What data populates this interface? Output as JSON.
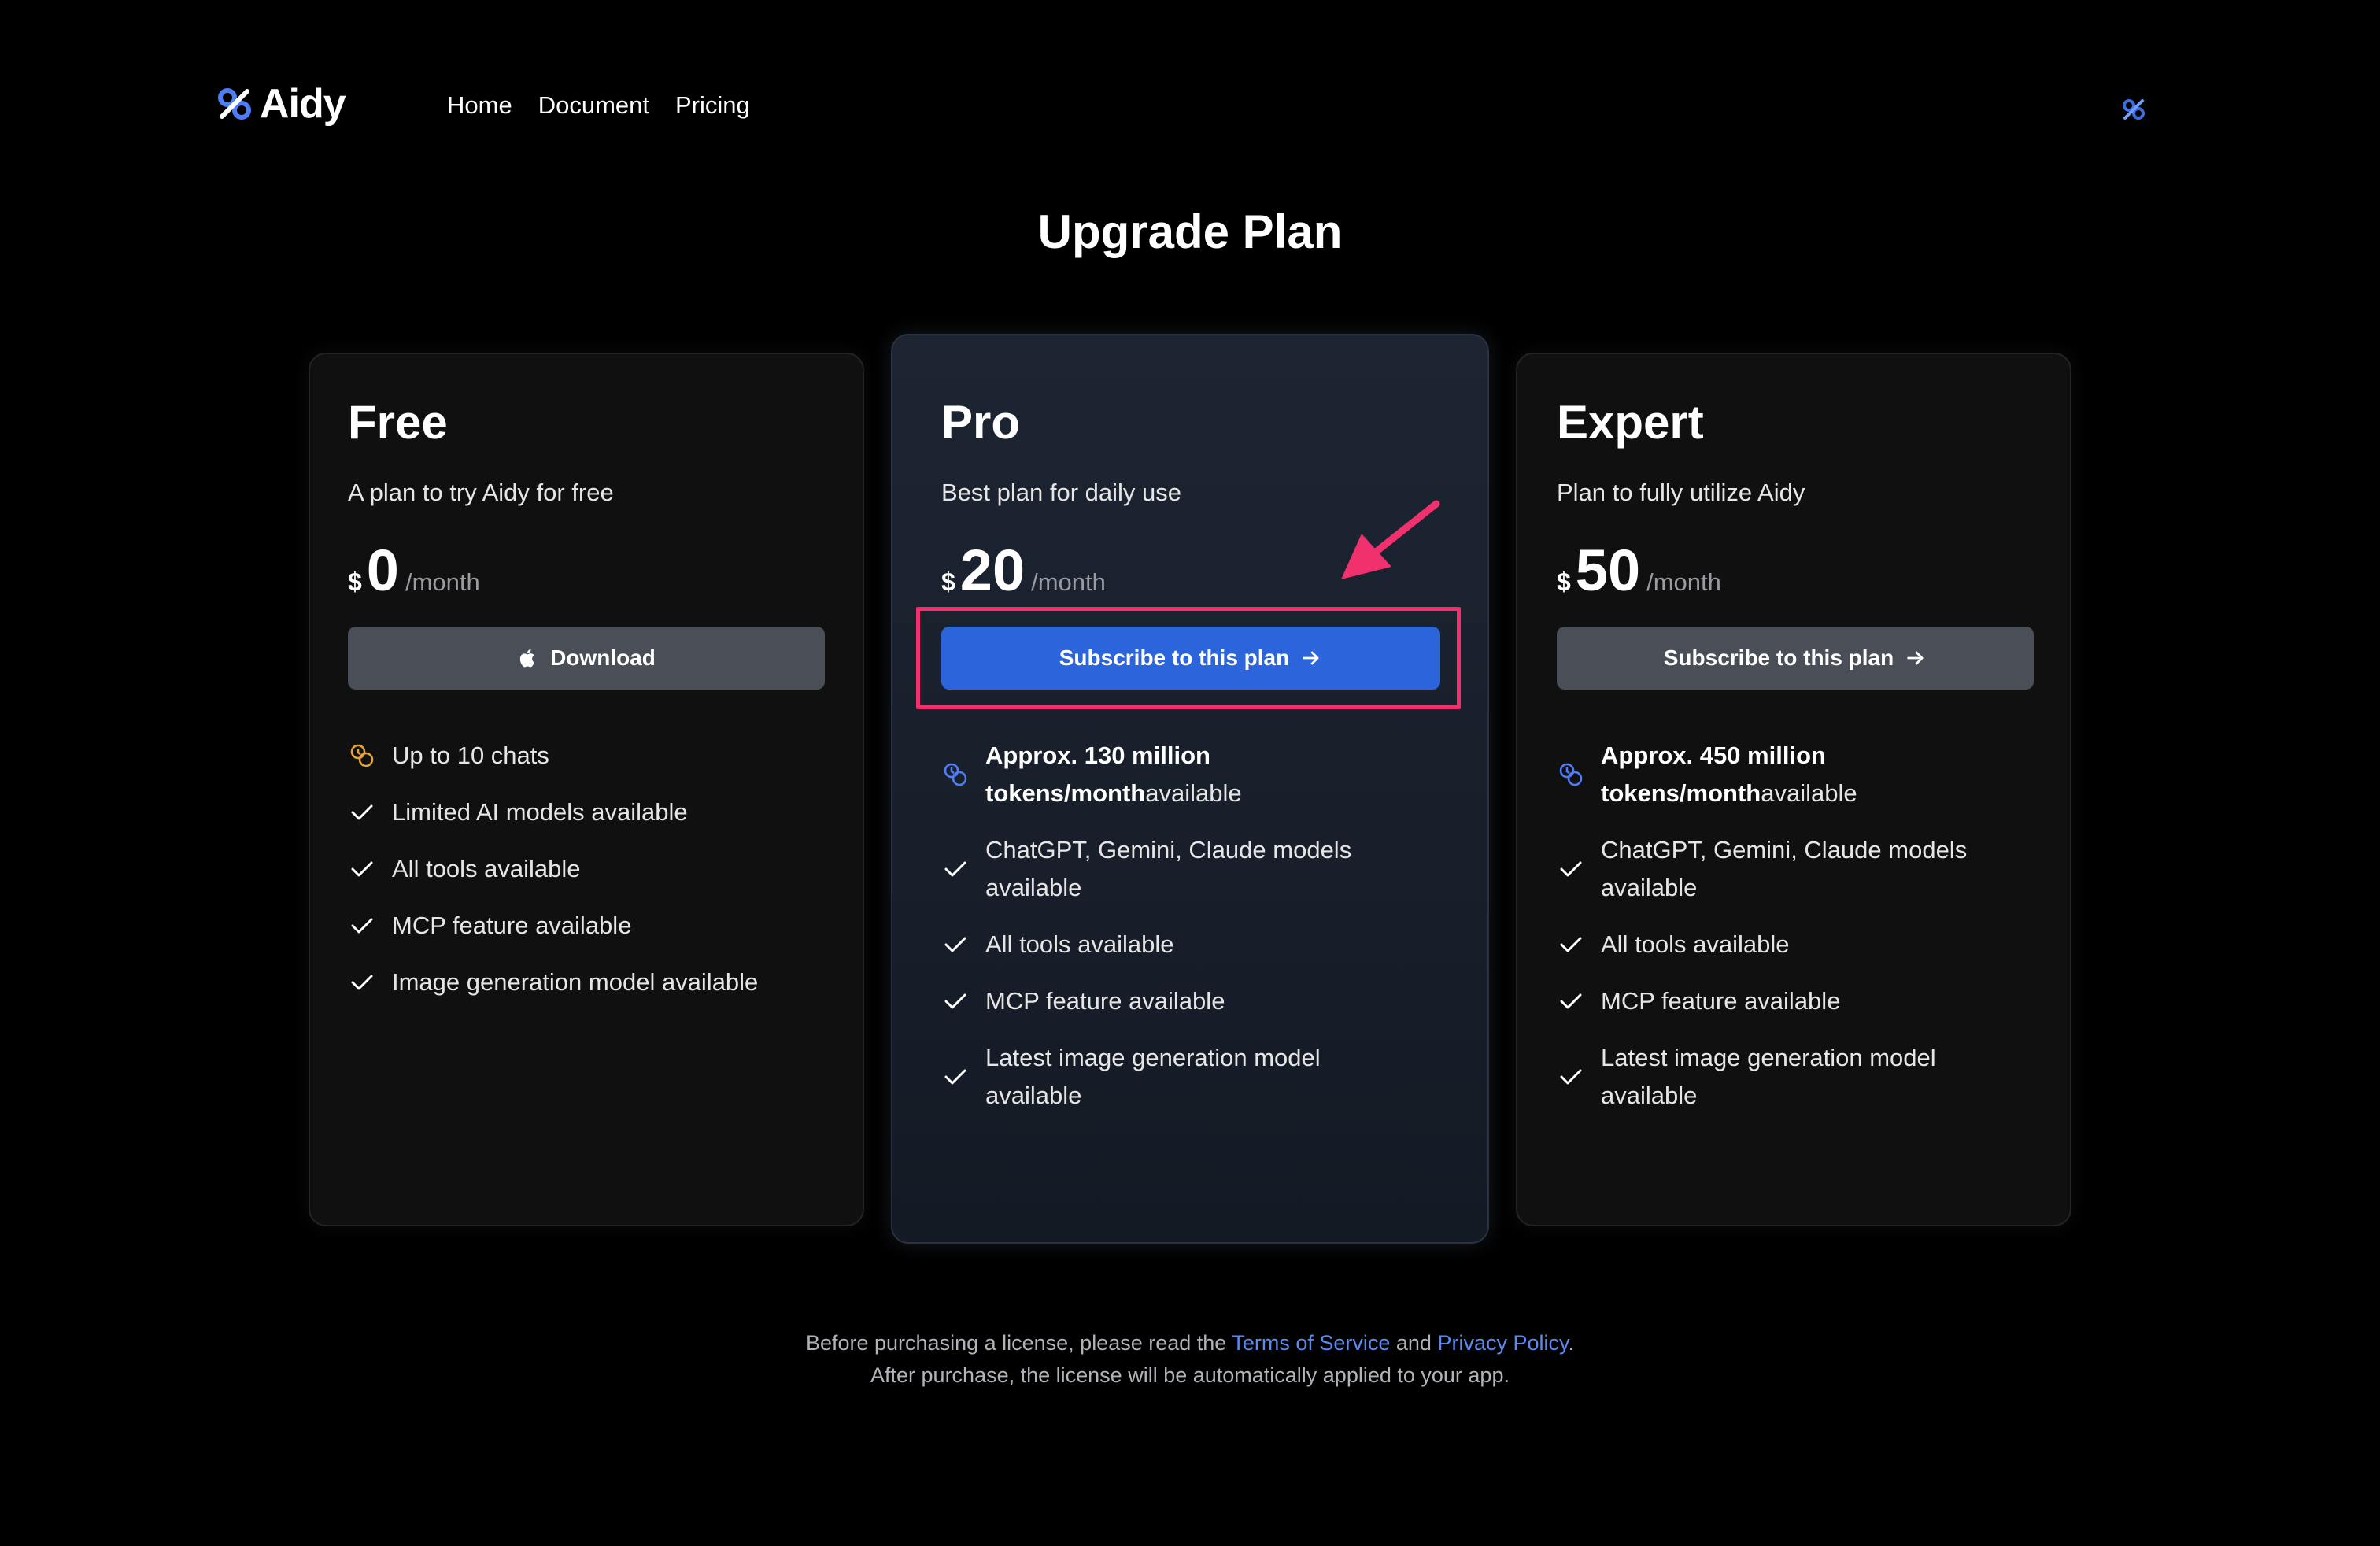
{
  "brand": {
    "name": "Aidy",
    "accent": "#2c65db",
    "mark_color": "#4f7df5"
  },
  "nav": {
    "items": [
      "Home",
      "Document",
      "Pricing"
    ]
  },
  "page_title": "Upgrade Plan",
  "plans": [
    {
      "name": "Free",
      "description": "A plan to try Aidy for free",
      "currency": "$",
      "amount": "0",
      "period": "/month",
      "button": {
        "label": "Download",
        "icon": "apple-icon"
      },
      "features": [
        {
          "text": "Up to 10 chats",
          "icon": "coins-icon",
          "icon_color": "#e8a23a"
        },
        {
          "text": "Limited AI models available",
          "icon": "check-icon"
        },
        {
          "text": "All tools available",
          "icon": "check-icon"
        },
        {
          "text": "MCP feature available",
          "icon": "check-icon"
        },
        {
          "text": "Image generation model available",
          "icon": "check-icon"
        }
      ]
    },
    {
      "name": "Pro",
      "description": "Best plan for daily use",
      "currency": "$",
      "amount": "20",
      "period": "/month",
      "button": {
        "label": "Subscribe to this plan",
        "icon": "arrow-right-icon"
      },
      "features": [
        {
          "strong": "Approx. 130 million",
          "strong2": "tokens/month",
          "text": "available",
          "icon": "coins-icon",
          "icon_color": "#4f7df5"
        },
        {
          "text": "ChatGPT, Gemini, Claude models",
          "text2": "available",
          "icon": "check-icon"
        },
        {
          "text": "All tools available",
          "icon": "check-icon"
        },
        {
          "text": "MCP feature available",
          "icon": "check-icon"
        },
        {
          "text": "Latest image generation model",
          "text2": "available",
          "icon": "check-icon"
        }
      ]
    },
    {
      "name": "Expert",
      "description": "Plan to fully utilize Aidy",
      "currency": "$",
      "amount": "50",
      "period": "/month",
      "button": {
        "label": "Subscribe to this plan",
        "icon": "arrow-right-icon"
      },
      "features": [
        {
          "strong": "Approx. 450 million",
          "strong2": "tokens/month",
          "text": "available",
          "icon": "coins-icon",
          "icon_color": "#4f7df5"
        },
        {
          "text": "ChatGPT, Gemini, Claude models",
          "text2": "available",
          "icon": "check-icon"
        },
        {
          "text": "All tools available",
          "icon": "check-icon"
        },
        {
          "text": "MCP feature available",
          "icon": "check-icon"
        },
        {
          "text": "Latest image generation model",
          "text2": "available",
          "icon": "check-icon"
        }
      ]
    }
  ],
  "footer": {
    "line1_pre": "Before purchasing a license, please read the ",
    "terms": "Terms of Service",
    "and": " and ",
    "privacy": "Privacy Policy",
    "period": ".",
    "line2": "After purchase, the license will be automatically applied to your app."
  },
  "annotation": {
    "color": "#f1306e"
  }
}
